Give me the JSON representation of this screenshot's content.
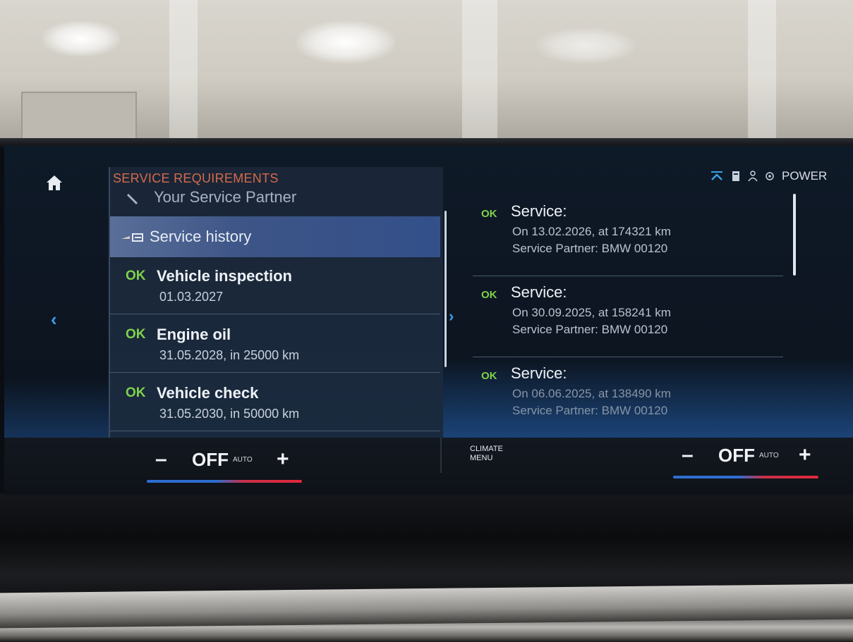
{
  "screen": {
    "panel_title": "SERVICE REQUIREMENTS",
    "menu": {
      "partner_label": "Your Service Partner",
      "history_label": "Service history"
    },
    "requirements": [
      {
        "status": "OK",
        "title": "Vehicle inspection",
        "detail": "01.03.2027"
      },
      {
        "status": "OK",
        "title": "Engine oil",
        "detail": "31.05.2028, in 25000 km"
      },
      {
        "status": "OK",
        "title": "Vehicle check",
        "detail": "31.05.2030, in 50000 km"
      }
    ],
    "history": [
      {
        "status": "OK",
        "title": "Service:",
        "line1": "On 13.02.2026, at 174321 km",
        "line2": "Service Partner: BMW 00120"
      },
      {
        "status": "OK",
        "title": "Service:",
        "line1": "On 30.09.2025, at 158241 km",
        "line2": "Service Partner: BMW 00120"
      },
      {
        "status": "OK",
        "title": "Service:",
        "line1": "On 06.06.2025, at 138490 km",
        "line2": "Service Partner: BMW 00120"
      }
    ],
    "status_bar": {
      "power_label": "POWER",
      "icons": [
        "chevron-up-icon",
        "document-icon",
        "person-icon",
        "eco-icon"
      ]
    },
    "climate": {
      "left": {
        "minus": "–",
        "mode": "OFF",
        "auto": "AUTO",
        "plus": "+"
      },
      "right": {
        "minus": "–",
        "mode": "OFF",
        "auto": "AUTO",
        "plus": "+"
      },
      "menu_line1": "CLIMATE",
      "menu_line2": "MENU"
    },
    "colors": {
      "ok": "#7fd34a",
      "title_accent": "#d56a4a",
      "selection": "#3d5587",
      "arrow": "#3aa0e8"
    }
  }
}
